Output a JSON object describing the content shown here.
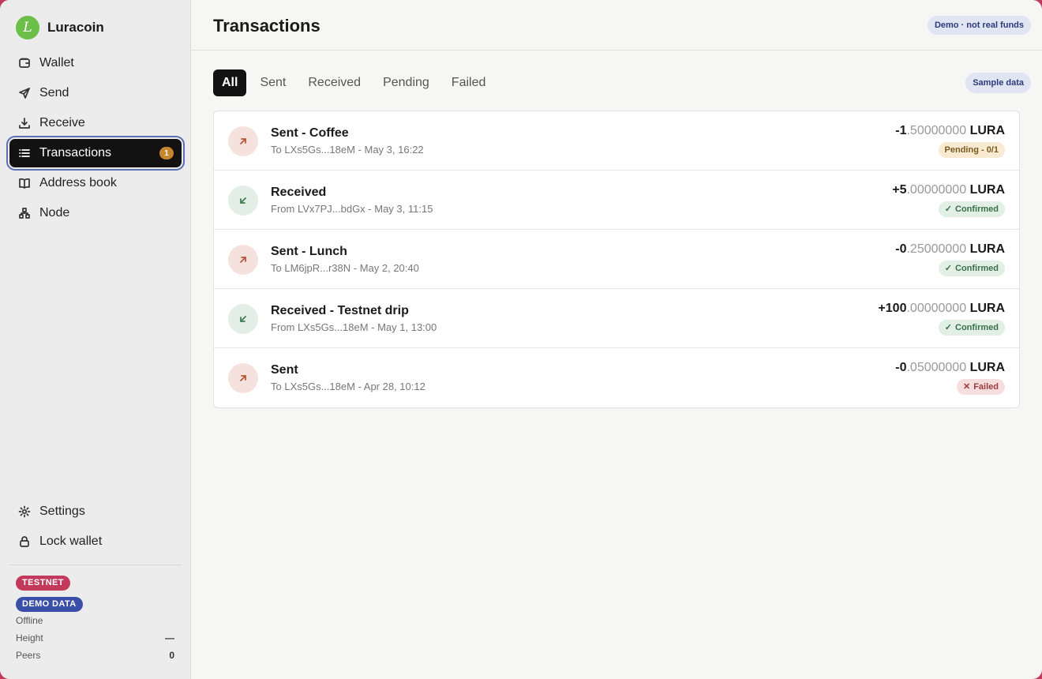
{
  "brand": {
    "logo_glyph": "L",
    "name": "Luracoin",
    "logo_color": "#6cbf48"
  },
  "nav": {
    "items": [
      {
        "label": "Wallet",
        "icon": "wallet-icon"
      },
      {
        "label": "Send",
        "icon": "send-icon"
      },
      {
        "label": "Receive",
        "icon": "download-icon"
      },
      {
        "label": "Transactions",
        "icon": "list-icon",
        "badge": "1",
        "active": true
      },
      {
        "label": "Address book",
        "icon": "book-icon"
      },
      {
        "label": "Node",
        "icon": "network-icon"
      }
    ],
    "bottom": [
      {
        "label": "Settings",
        "icon": "gear-icon"
      },
      {
        "label": "Lock wallet",
        "icon": "lock-icon"
      }
    ]
  },
  "status": {
    "network_pill": "TESTNET",
    "demo_pill": "DEMO DATA",
    "connection": "Offline",
    "height_label": "Height",
    "height_value": "—",
    "peers_label": "Peers",
    "peers_value": "0"
  },
  "header": {
    "title": "Transactions",
    "demo_pill": "Demo · not real funds"
  },
  "tabs": [
    "All",
    "Sent",
    "Received",
    "Pending",
    "Failed"
  ],
  "active_tab": "All",
  "sample_pill": "Sample data",
  "transactions": [
    {
      "direction": "out",
      "title": "Sent - Coffee",
      "sub": "To LXs5Gs...18eM - May 3, 16:22",
      "amount_int": "-1",
      "amount_frac": ".50000000",
      "unit": "LURA",
      "status": "pending",
      "status_label": "Pending - 0/1"
    },
    {
      "direction": "in",
      "title": "Received",
      "sub": "From LVx7PJ...bdGx - May 3, 11:15",
      "amount_int": "+5",
      "amount_frac": ".00000000",
      "unit": "LURA",
      "status": "confirmed",
      "status_label": "Confirmed"
    },
    {
      "direction": "out",
      "title": "Sent - Lunch",
      "sub": "To LM6jpR...r38N - May 2, 20:40",
      "amount_int": "-0",
      "amount_frac": ".25000000",
      "unit": "LURA",
      "status": "confirmed",
      "status_label": "Confirmed"
    },
    {
      "direction": "in",
      "title": "Received - Testnet drip",
      "sub": "From LXs5Gs...18eM - May 1, 13:00",
      "amount_int": "+100",
      "amount_frac": ".00000000",
      "unit": "LURA",
      "status": "confirmed",
      "status_label": "Confirmed"
    },
    {
      "direction": "out",
      "title": "Sent",
      "sub": "To LXs5Gs...18eM - Apr 28, 10:12",
      "amount_int": "-0",
      "amount_frac": ".05000000",
      "unit": "LURA",
      "status": "failed",
      "status_label": "Failed"
    }
  ],
  "colors": {
    "accent": "#121212",
    "testnet": "#c23a5b",
    "demo": "#3a4fa8",
    "pending": "#c7862e"
  }
}
